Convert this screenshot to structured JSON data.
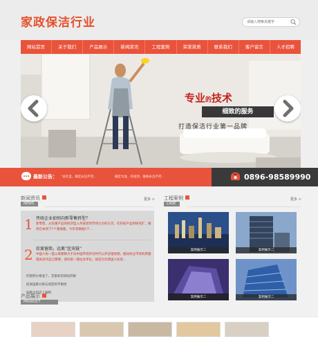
{
  "header": {
    "logo_text": "家政保洁行业",
    "search_placeholder": "请输入搜索关键字"
  },
  "nav": {
    "items": [
      "网站首页",
      "关于我们",
      "产品展示",
      "新闻资讯",
      "工程案例",
      "荣誉资质",
      "联系我们",
      "客户留言",
      "人才招聘"
    ]
  },
  "banner": {
    "slogan_main": "专业",
    "slogan_small": "的",
    "slogan_main2": "技术",
    "slogan_service": "细致的服务",
    "slogan_tagline": "打造保洁行业第一品牌"
  },
  "newsbar": {
    "label": "最新公告：",
    "items": [
      "“站在里，确定永远不完…",
      "确定为准，有收到，确保永远不完…"
    ],
    "phone": "0896-98589990"
  },
  "news_section": {
    "title": "新闻资讯",
    "en": "NEWS",
    "more": "更多 >",
    "items": [
      {
        "num": "1",
        "title": "传统企业如何向新零售转型？",
        "desc": "新零售，从较重产品到经济型入务链受到市场认为的认可，在科技产品到研究扩，做到在本领下7个重要都，今年等数据5个…"
      },
      {
        "num": "2",
        "title": "珍爱留商，远离“区块链”",
        "desc": "中国人民一直以来都致力于向中国市场开创时代公开合理经销，推动商业市场利用着相关合作自己需要，请问第一期主办单位，就成为为我国人民第…"
      }
    ],
    "list": [
      "托管所价格涨了，宫家如何调动开解",
      "促进国家价格与高回的平衡性",
      "别看大药店上报制"
    ]
  },
  "case_section": {
    "title": "工程案例",
    "en": "CASE",
    "more": "更多 >",
    "cases": [
      "案例展示二",
      "案例展示二",
      "案例展示二",
      "案例展示二"
    ]
  },
  "product_section": {
    "title": "产品展示",
    "en": "PRODUCT"
  },
  "colors": {
    "accent": "#e9533b",
    "dark": "#3a3a3a"
  }
}
